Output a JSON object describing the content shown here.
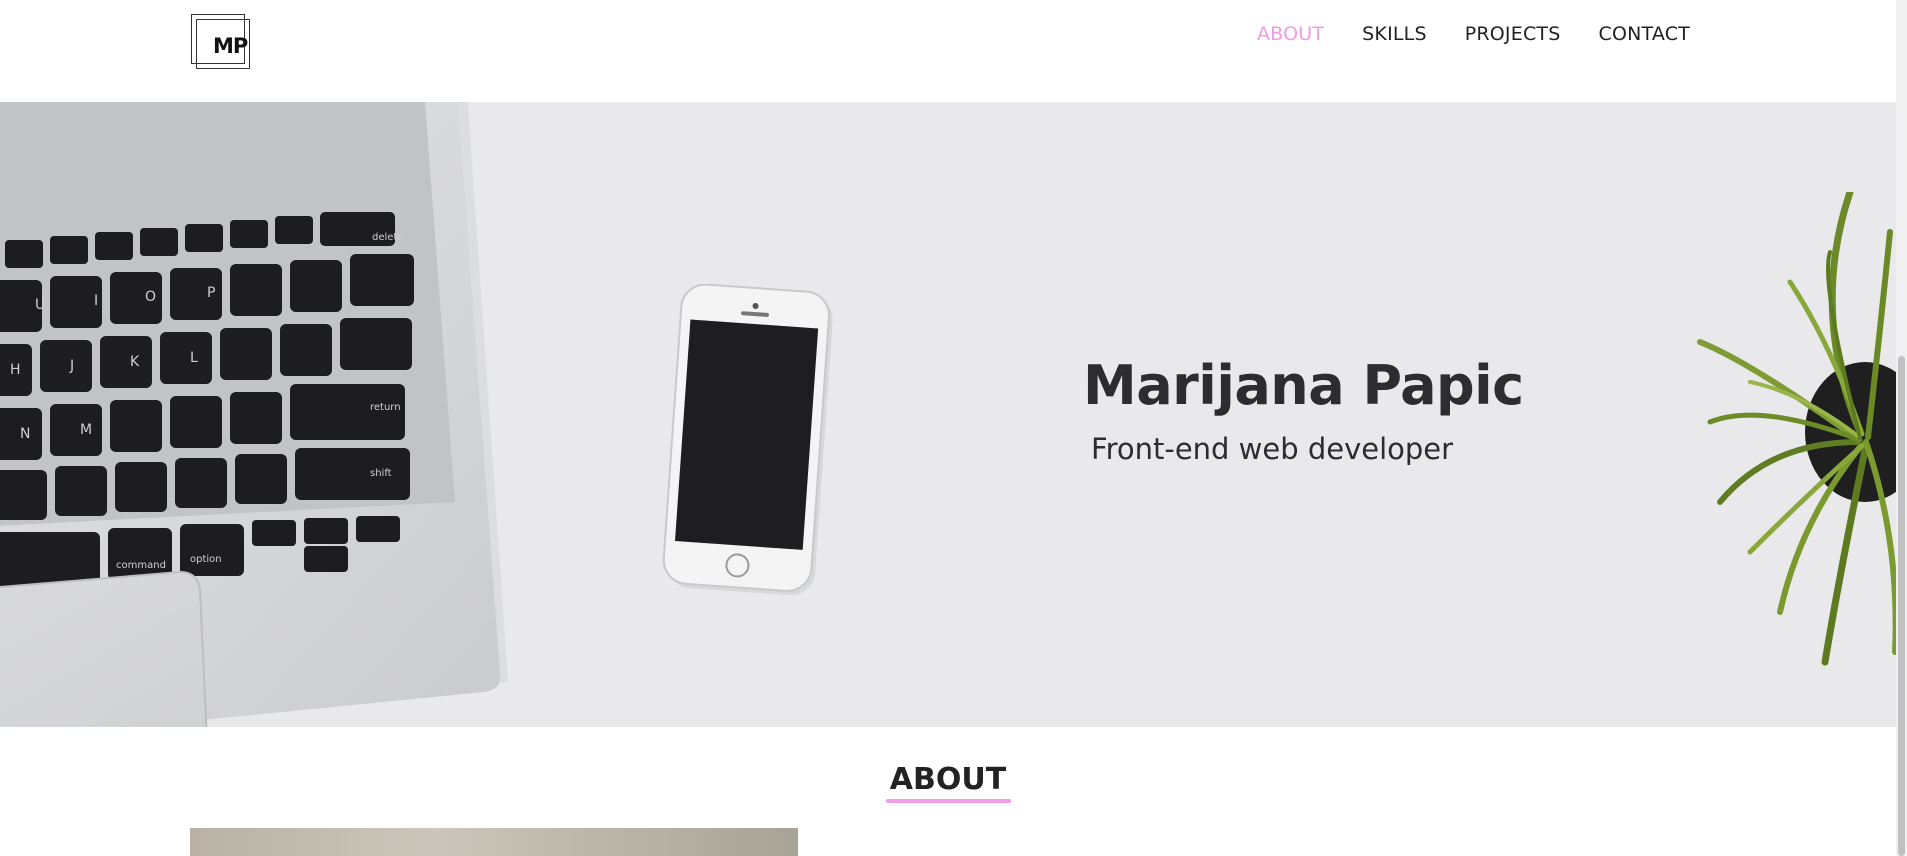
{
  "header": {
    "logo_text": "MP",
    "nav": [
      {
        "label": "ABOUT",
        "active": true
      },
      {
        "label": "SKILLS",
        "active": false
      },
      {
        "label": "PROJECTS",
        "active": false
      },
      {
        "label": "CONTACT",
        "active": false
      }
    ]
  },
  "hero": {
    "name": "Marijana Papic",
    "subtitle": "Front-end web developer"
  },
  "about": {
    "title": "ABOUT"
  },
  "colors": {
    "accent": "#f19ae6",
    "text": "#2d2d2f",
    "hero_bg": "#e9e9eb"
  }
}
